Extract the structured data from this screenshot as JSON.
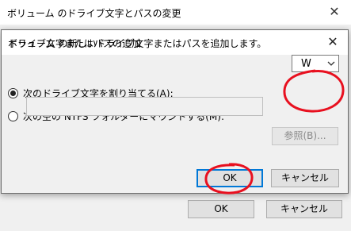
{
  "background_dialog": {
    "title": "ボリューム のドライブ文字とパスの変更",
    "ok_label": "OK",
    "cancel_label": "キャンセル"
  },
  "dialog": {
    "title": "ドライブ文字またはパスの追加",
    "description": "ボリューム の新しいドライブ文字またはパスを追加します。",
    "assign_letter": {
      "label": "次のドライブ文字を割り当てる(A):",
      "selected": true,
      "drive_letter": "W"
    },
    "mount_folder": {
      "label": "次の空の NTFS フォルダーにマウントする(M):",
      "selected": false,
      "path_value": ""
    },
    "browse_label": "参照(B)...",
    "ok_label": "OK",
    "cancel_label": "キャンセル"
  },
  "annotation_color": "#e8101f",
  "icons": {
    "close": "close-icon",
    "dropdown": "chevron-down-icon"
  }
}
